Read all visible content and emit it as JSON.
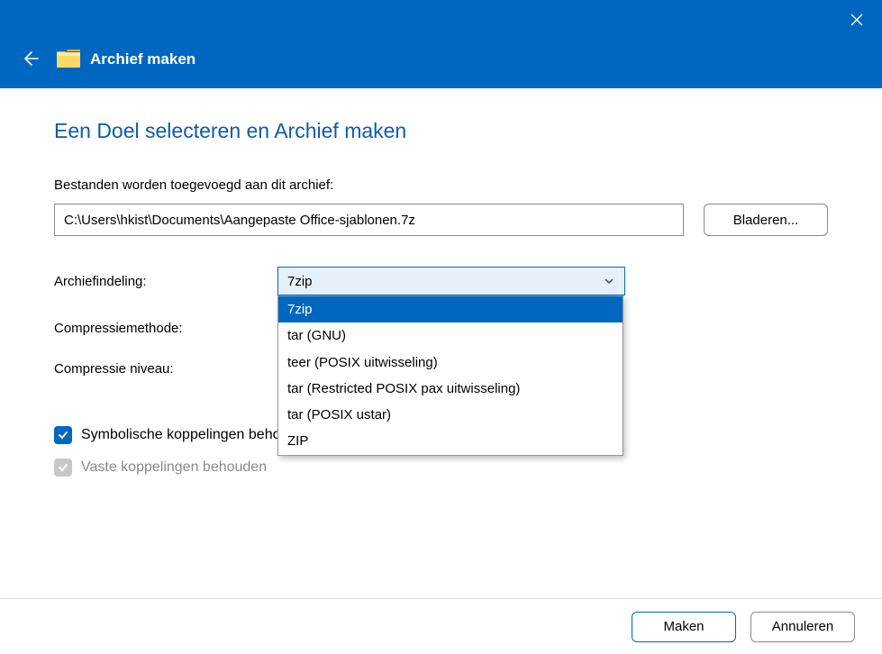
{
  "titlebar": {
    "title": "Archief maken"
  },
  "heading": "Een Doel selecteren en Archief maken",
  "path_label": "Bestanden worden toegevoegd aan dit archief:",
  "path_value": "C:\\Users\\hkist\\Documents\\Aangepaste Office-sjablonen.7z",
  "browse_label": "Bladeren...",
  "labels": {
    "format": "Archiefindeling:",
    "method": "Compressiemethode:",
    "level": "Compressie niveau:"
  },
  "format_select": {
    "value": "7zip",
    "options": [
      "7zip",
      "tar (GNU)",
      "teer (POSIX uitwisseling)",
      "tar (Restricted POSIX pax uitwisseling)",
      "tar (POSIX ustar)",
      "ZIP"
    ]
  },
  "checks": {
    "symlinks": "Symbolische koppelingen behouden",
    "hardlinks": "Vaste koppelingen behouden"
  },
  "footer": {
    "make": "Maken",
    "cancel": "Annuleren"
  }
}
